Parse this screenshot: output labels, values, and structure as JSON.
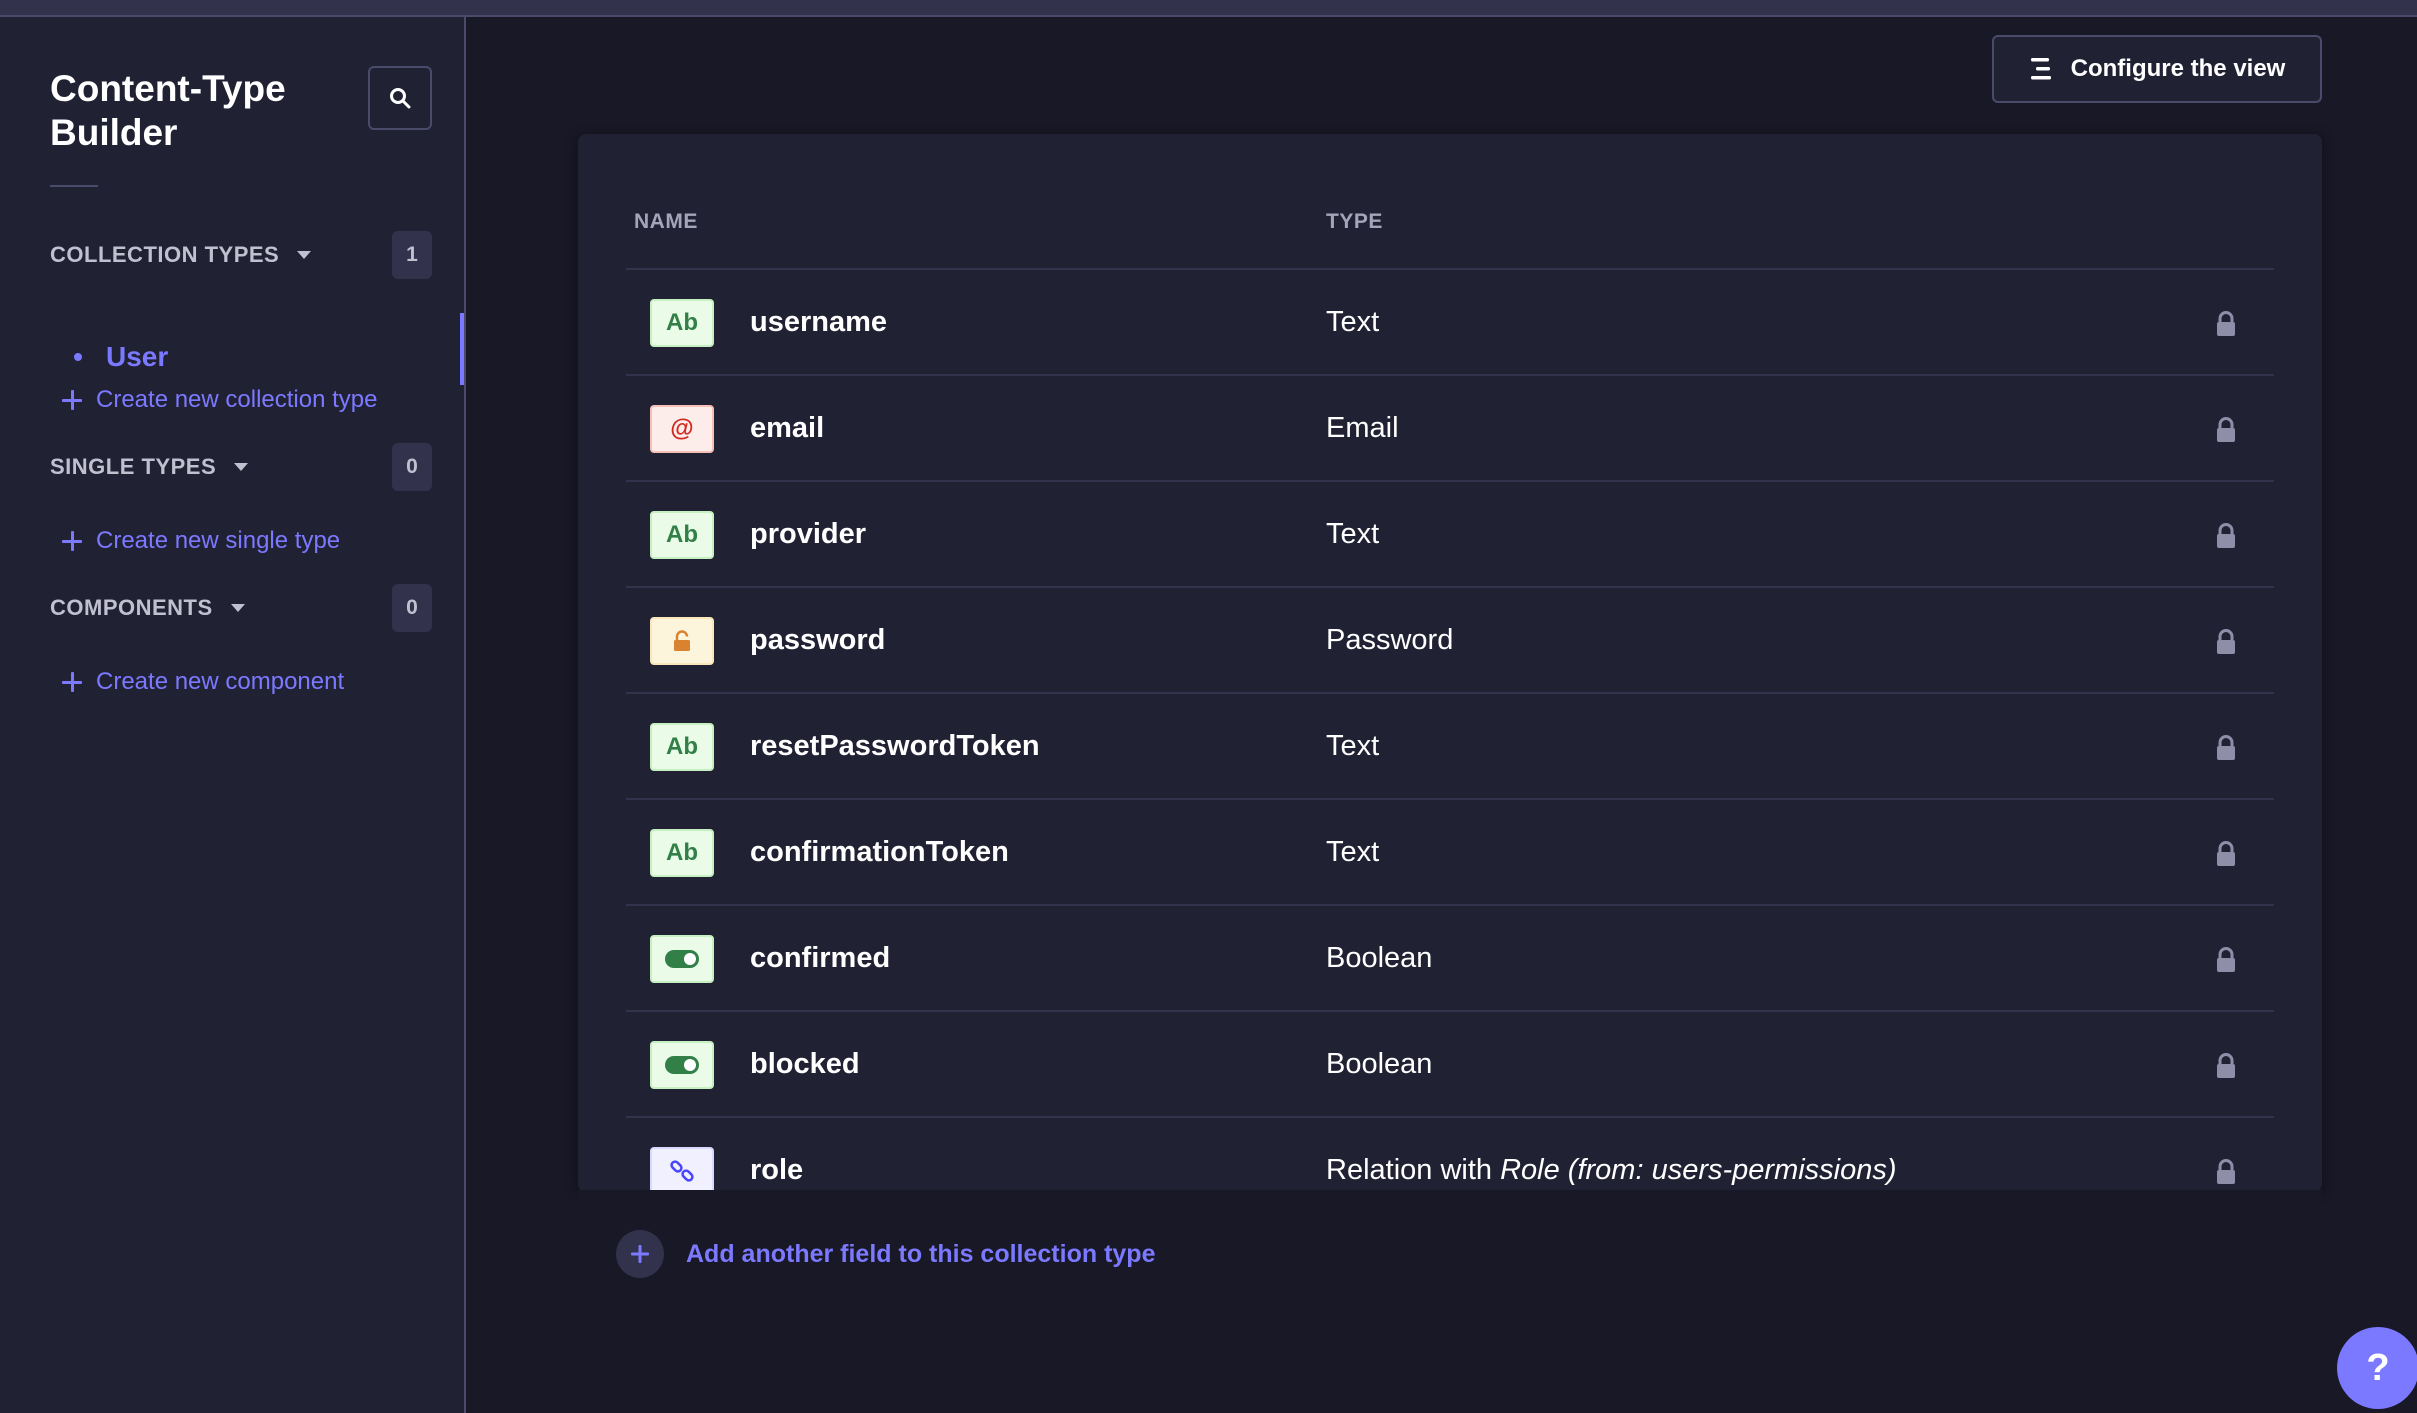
{
  "sidebar": {
    "title": "Content-Type Builder",
    "sections": {
      "collection": {
        "label": "COLLECTION TYPES",
        "count": "1",
        "items": [
          {
            "label": "User"
          }
        ],
        "create_label": "Create new collection type"
      },
      "single": {
        "label": "SINGLE TYPES",
        "count": "0",
        "create_label": "Create new single type"
      },
      "components": {
        "label": "COMPONENTS",
        "count": "0",
        "create_label": "Create new component"
      }
    }
  },
  "toolbar": {
    "configure_label": "Configure the view"
  },
  "table": {
    "columns": {
      "name": "NAME",
      "type": "TYPE"
    },
    "rows": [
      {
        "icon": "text-icon",
        "icon_text": "Ab",
        "name": "username",
        "type": "Text"
      },
      {
        "icon": "email-icon",
        "icon_text": "@",
        "name": "email",
        "type": "Email"
      },
      {
        "icon": "text-icon",
        "icon_text": "Ab",
        "name": "provider",
        "type": "Text"
      },
      {
        "icon": "password-icon",
        "icon_text": "",
        "name": "password",
        "type": "Password"
      },
      {
        "icon": "text-icon",
        "icon_text": "Ab",
        "name": "resetPasswordToken",
        "type": "Text"
      },
      {
        "icon": "text-icon",
        "icon_text": "Ab",
        "name": "confirmationToken",
        "type": "Text"
      },
      {
        "icon": "boolean-icon",
        "icon_text": "",
        "name": "confirmed",
        "type": "Boolean"
      },
      {
        "icon": "boolean-icon",
        "icon_text": "",
        "name": "blocked",
        "type": "Boolean"
      },
      {
        "icon": "relation-icon",
        "icon_text": "",
        "name": "role",
        "type_prefix": "Relation with ",
        "type_target": "Role",
        "type_suffix": " (from: users-permissions)"
      }
    ]
  },
  "footer": {
    "add_field_label": "Add another field to this collection type"
  },
  "help": {
    "label": "?"
  },
  "colors": {
    "accent": "#7b79ff",
    "background": "#181826",
    "panel": "#212134",
    "border": "#4a4a6a"
  }
}
